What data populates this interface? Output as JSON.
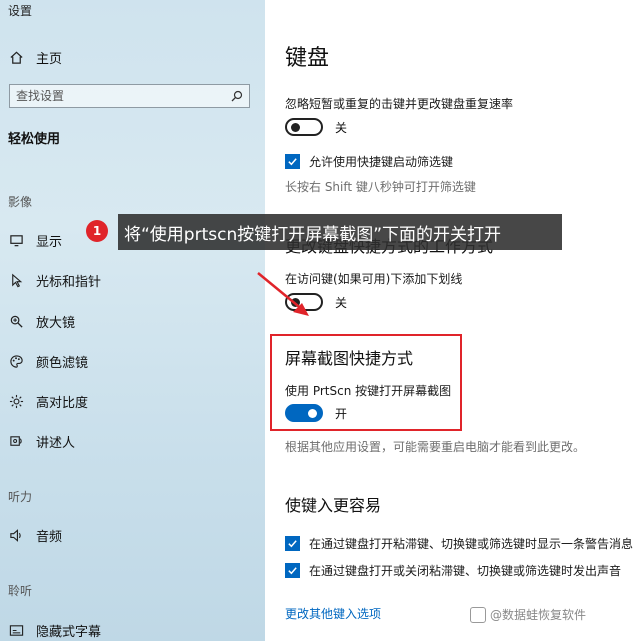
{
  "window": {
    "title": "设置"
  },
  "sidebar": {
    "home_label": "主页",
    "search_placeholder": "查找设置",
    "current_section": "轻松使用",
    "groups": [
      {
        "label": "影像"
      },
      {
        "label": "听力"
      },
      {
        "label": "聆听"
      }
    ],
    "items": [
      {
        "label": "显示",
        "icon": "monitor-icon"
      },
      {
        "label": "光标和指针",
        "icon": "cursor-icon"
      },
      {
        "label": "放大镜",
        "icon": "magnifier-icon"
      },
      {
        "label": "颜色滤镜",
        "icon": "palette-icon"
      },
      {
        "label": "高对比度",
        "icon": "brightness-icon"
      },
      {
        "label": "讲述人",
        "icon": "narrator-icon"
      },
      {
        "label": "音频",
        "icon": "speaker-icon"
      },
      {
        "label": "隐藏式字幕",
        "icon": "caption-icon"
      }
    ]
  },
  "main": {
    "title": "键盘",
    "filter_keys": {
      "text": "忽略短暂或重复的击键并更改键盘重复速率",
      "toggle_label": "关",
      "toggle_on": false,
      "checkbox_label": "允许使用快捷键启动筛选键",
      "checked": true,
      "hint": "长按右 Shift 键八秒钟可打开筛选键"
    },
    "shortcut_section": {
      "heading": "更改键盘快捷方式的工作方式",
      "text": "在访问键(如果可用)下添加下划线",
      "toggle_label": "关",
      "toggle_on": false
    },
    "prtscn_section": {
      "heading": "屏幕截图快捷方式",
      "text": "使用 PrtScn 按键打开屏幕截图",
      "toggle_label": "开",
      "toggle_on": true,
      "hint": "根据其他应用设置，可能需要重启电脑才能看到此更改。"
    },
    "typing_section": {
      "heading": "使键入更容易",
      "checkbox1": "在通过键盘打开粘滞键、切换键或筛选键时显示一条警告消息",
      "checkbox2": "在通过键盘打开或关闭粘滞键、切换键或筛选键时发出声音",
      "link": "更改其他键入选项"
    }
  },
  "annotation": {
    "step": "1",
    "text": "将“使用prtscn按键打开屏幕截图”下面的开关打开",
    "highlight_color": "#e0242a"
  },
  "watermark": {
    "text": "@数据蛙恢复软件"
  },
  "colors": {
    "accent": "#0067c0",
    "annotation_red": "#e0242a"
  }
}
